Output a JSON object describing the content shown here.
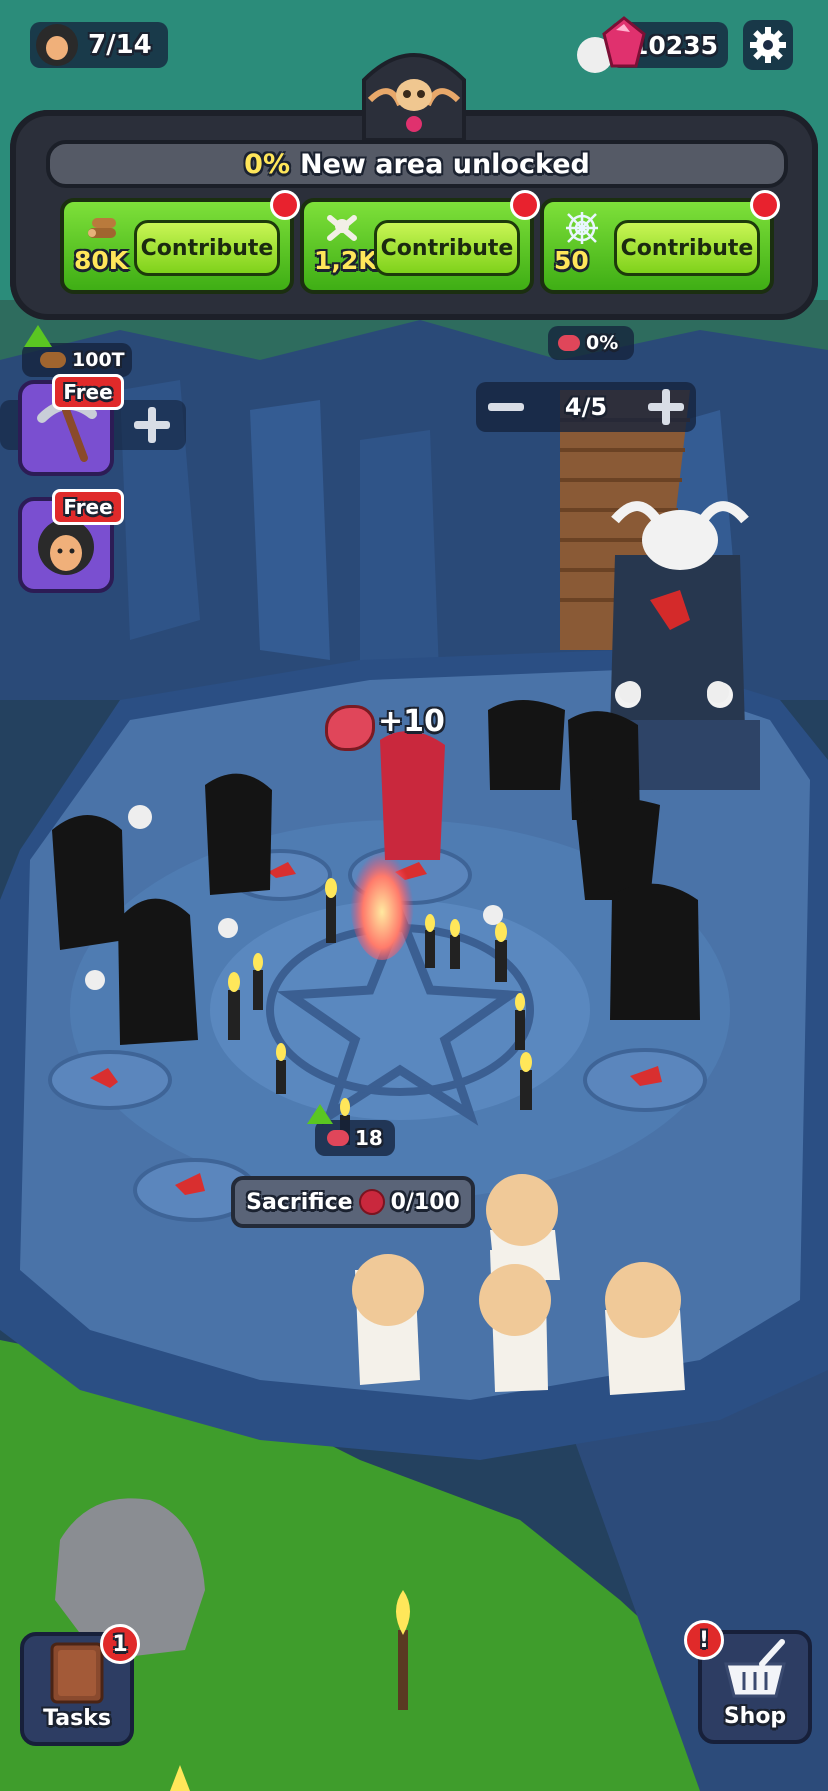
{
  "hud": {
    "population": "7/14",
    "gems": "10235",
    "colors": {
      "gem": "#e0316e",
      "accent_green": "#5ac622"
    }
  },
  "area": {
    "percent": "0%",
    "label": "New area unlocked",
    "contributions": [
      {
        "amount": "80K",
        "button": "Contribute",
        "icon": "wood-logs-icon"
      },
      {
        "amount": "1,2K",
        "button": "Contribute",
        "icon": "bones-icon"
      },
      {
        "amount": "50",
        "button": "Contribute",
        "icon": "spiderweb-icon"
      }
    ]
  },
  "resources": {
    "wood_cost": "100T",
    "meat_percent": "0%",
    "cultist_slots": "4/5",
    "meat_count": "18",
    "meat_popup": "+10"
  },
  "side_buttons": [
    {
      "tag": "Free",
      "icon": "pickaxe-icon"
    },
    {
      "tag": "Free",
      "icon": "cultist-face-icon"
    }
  ],
  "sacrifice": {
    "label": "Sacrifice",
    "value": "0/100"
  },
  "bottom": {
    "tasks_label": "Tasks",
    "tasks_badge": "1",
    "shop_label": "Shop",
    "shop_badge": "!"
  }
}
